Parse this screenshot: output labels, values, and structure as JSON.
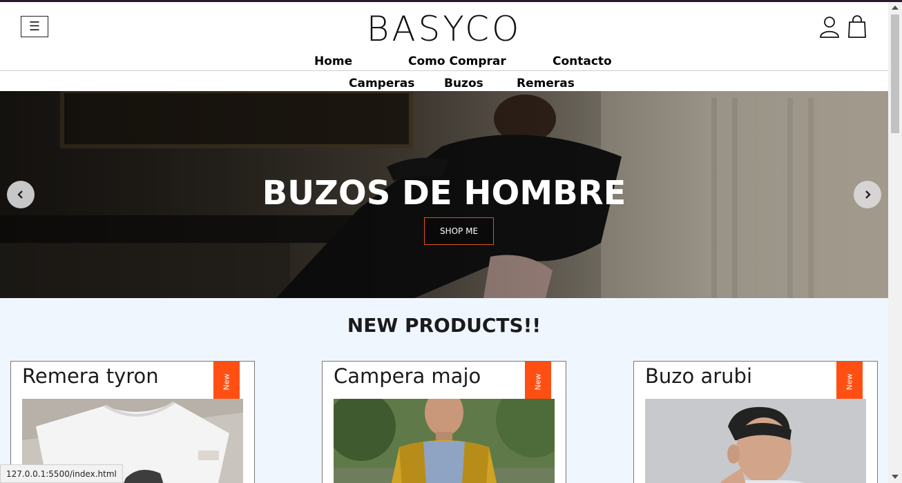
{
  "brand": {
    "logo_text": "BASYCO"
  },
  "header": {
    "menu_icon": "hamburger-icon",
    "user_icon": "user-icon",
    "cart_icon": "shopping-bag-icon"
  },
  "main_nav": [
    "Home",
    "Como Comprar",
    "Contacto"
  ],
  "sub_nav": [
    "Camperas",
    "Buzos",
    "Remeras"
  ],
  "hero": {
    "title": "BUZOS DE HOMBRE",
    "button_label": "SHOP ME",
    "prev_icon": "chevron-left-icon",
    "next_icon": "chevron-right-icon"
  },
  "products_section": {
    "title": "NEW PRODUCTS!!",
    "items": [
      {
        "name": "Remera tyron",
        "badge": "New"
      },
      {
        "name": "Campera majo",
        "badge": "New"
      },
      {
        "name": "Buzo arubi",
        "badge": "New"
      }
    ]
  },
  "status_bar": {
    "url": "127.0.0.1:5500/index.html"
  },
  "colors": {
    "accent": "#ff4f12",
    "page_bg": "#f0f6fd",
    "button_border": "#e0531f"
  }
}
